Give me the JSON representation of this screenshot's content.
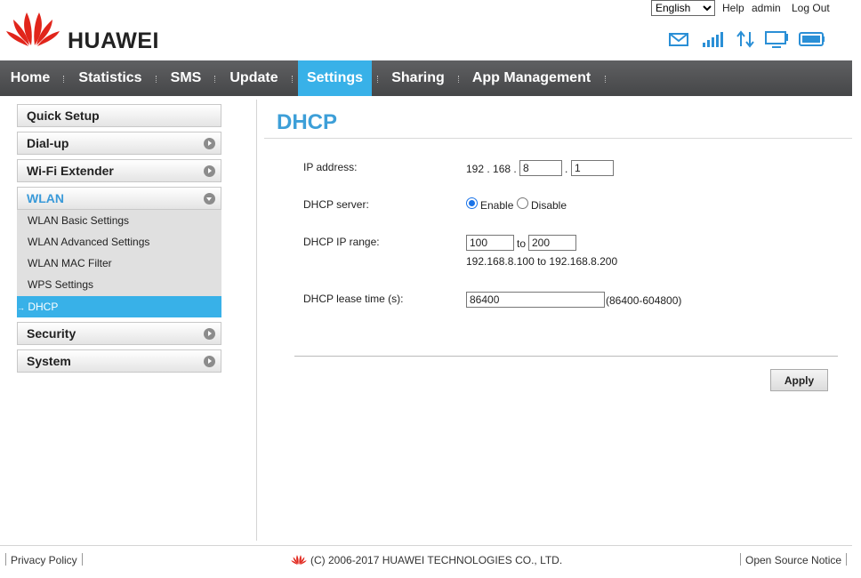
{
  "header": {
    "logo_text": "HUAWEI",
    "language_selected": "English",
    "help": "Help",
    "user": "admin",
    "logout": "Log Out",
    "status_icons": [
      "envelope-icon",
      "signal-icon",
      "data-transfer-icon",
      "monitor-icon",
      "battery-icon"
    ],
    "accent": "#38b1e8",
    "logo_color": "#e1251b"
  },
  "nav": {
    "items": [
      "Home",
      "Statistics",
      "SMS",
      "Update",
      "Settings",
      "Sharing",
      "App Management"
    ],
    "active": "Settings"
  },
  "sidebar": {
    "quick_setup": "Quick Setup",
    "dialup": "Dial-up",
    "wifi_extender": "Wi-Fi Extender",
    "wlan": "WLAN",
    "wlan_items": [
      "WLAN Basic Settings",
      "WLAN Advanced Settings",
      "WLAN MAC Filter",
      "WPS Settings",
      "DHCP"
    ],
    "active_item_marker": "→",
    "security": "Security",
    "system": "System"
  },
  "content": {
    "title": "DHCP",
    "ip_label": "IP address:",
    "ip_prefix": "192 . 168 .",
    "ip_octet3": "8",
    "ip_dot": ".",
    "ip_octet4": "1",
    "server_label": "DHCP server:",
    "enable_label": "Enable",
    "disable_label": "Disable",
    "server_enabled": true,
    "range_label": "DHCP IP range:",
    "range_start": "100",
    "range_to": "to",
    "range_end": "200",
    "range_summary": "192.168.8.100 to 192.168.8.200",
    "lease_label": "DHCP lease time (s):",
    "lease_value": "86400",
    "lease_hint": "(86400-604800)",
    "apply": "Apply"
  },
  "footer": {
    "privacy": "Privacy Policy",
    "copyright": "(C) 2006-2017 HUAWEI TECHNOLOGIES CO., LTD.",
    "open_source": "Open Source Notice"
  }
}
